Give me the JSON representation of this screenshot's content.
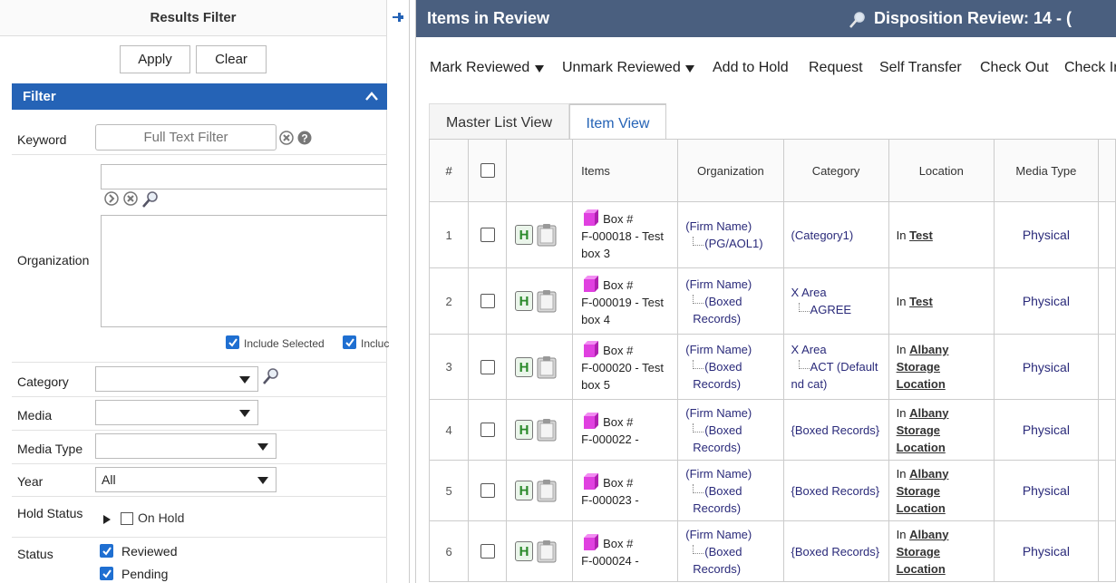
{
  "left_panel": {
    "title": "Results Filter",
    "apply_label": "Apply",
    "clear_label": "Clear",
    "filter_header": "Filter",
    "keyword": {
      "label": "Keyword",
      "placeholder": "Full Text Filter"
    },
    "organization": {
      "label": "Organization",
      "include_selected": "Include Selected",
      "include_other": "Incluc"
    },
    "category": {
      "label": "Category",
      "value": ""
    },
    "media": {
      "label": "Media",
      "value": ""
    },
    "media_type": {
      "label": "Media Type",
      "value": ""
    },
    "year": {
      "label": "Year",
      "value": "All"
    },
    "hold_status": {
      "label": "Hold Status",
      "on_hold": "On Hold"
    },
    "status": {
      "label": "Status",
      "options": [
        "Reviewed",
        "Pending"
      ]
    }
  },
  "header": {
    "title": "Items in Review",
    "disposition": "Disposition Review: 14 - ("
  },
  "toolbar": {
    "mark_reviewed": "Mark Reviewed",
    "unmark_reviewed": "Unmark Reviewed",
    "add_to_hold": "Add to Hold",
    "request": "Request",
    "self_transfer": "Self Transfer",
    "check_out": "Check Out",
    "check_in": "Check In"
  },
  "tabs": [
    "Master List View",
    "Item View"
  ],
  "table": {
    "columns": [
      "#",
      "",
      "",
      "Items",
      "Organization",
      "Category",
      "Location",
      "Media Type"
    ],
    "hold_glyph": "H",
    "rows": [
      {
        "num": "1",
        "item": [
          "Box #",
          "F-000018 - Test",
          "box 3"
        ],
        "org_parent": "(Firm Name)",
        "org_child": [
          "(PG/AOL1)"
        ],
        "cat_parent": "(Category1)",
        "cat_child": [],
        "loc_prefix": "In",
        "loc_link": [
          "Test"
        ],
        "media": "Physical"
      },
      {
        "num": "2",
        "item": [
          "Box #",
          "F-000019 - Test",
          "box 4"
        ],
        "org_parent": "(Firm Name)",
        "org_child": [
          "(Boxed",
          "Records)"
        ],
        "cat_parent": "X Area",
        "cat_child": [
          "AGREE"
        ],
        "loc_prefix": "In",
        "loc_link": [
          "Test"
        ],
        "media": "Physical"
      },
      {
        "num": "3",
        "item": [
          "Box #",
          "F-000020 - Test",
          "box 5"
        ],
        "org_parent": "(Firm Name)",
        "org_child": [
          "(Boxed",
          "Records)"
        ],
        "cat_parent": "X Area",
        "cat_child": [
          "ACT (Default",
          "nd cat)"
        ],
        "loc_prefix": "In",
        "loc_link": [
          "Albany",
          "Storage",
          "Location"
        ],
        "media": "Physical"
      },
      {
        "num": "4",
        "item": [
          "Box #",
          "F-000022 -"
        ],
        "org_parent": "(Firm Name)",
        "org_child": [
          "(Boxed",
          "Records)"
        ],
        "cat_parent": "{Boxed Records}",
        "cat_child": [],
        "loc_prefix": "In",
        "loc_link": [
          "Albany",
          "Storage",
          "Location"
        ],
        "media": "Physical"
      },
      {
        "num": "5",
        "item": [
          "Box #",
          "F-000023 -"
        ],
        "org_parent": "(Firm Name)",
        "org_child": [
          "(Boxed",
          "Records)"
        ],
        "cat_parent": "{Boxed Records}",
        "cat_child": [],
        "loc_prefix": "In",
        "loc_link": [
          "Albany",
          "Storage",
          "Location"
        ],
        "media": "Physical"
      },
      {
        "num": "6",
        "item": [
          "Box #",
          "F-000024 -"
        ],
        "org_parent": "(Firm Name)",
        "org_child": [
          "(Boxed",
          "Records)"
        ],
        "cat_parent": "{Boxed Records}",
        "cat_child": [],
        "loc_prefix": "In",
        "loc_link": [
          "Albany",
          "Storage",
          "Location"
        ],
        "media": "Physical"
      }
    ]
  },
  "colors": {
    "accent": "#2563b6",
    "header_bg": "#4a5f7f",
    "box_icon": "#e040e0",
    "hold_icon": "#2b8a2b"
  }
}
